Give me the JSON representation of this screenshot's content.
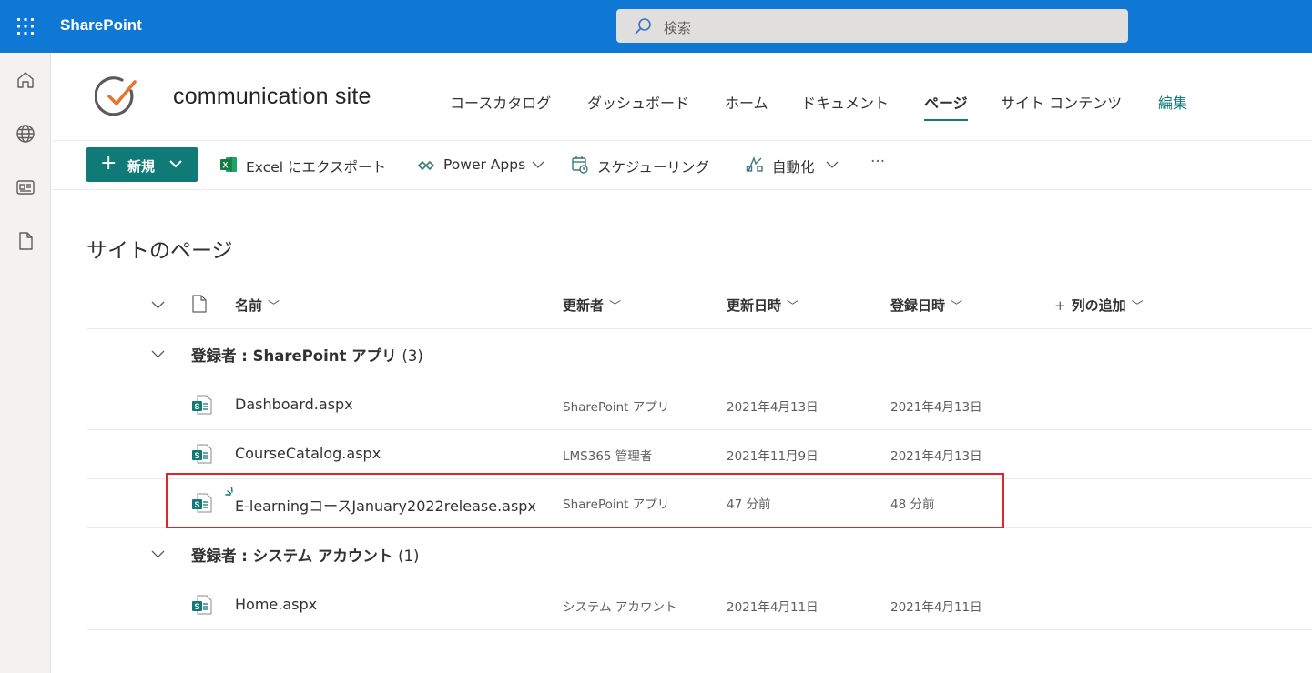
{
  "suite_bar": {
    "app_name": "SharePoint",
    "search_placeholder": "検索",
    "background": "#0f78d4"
  },
  "app_bar": {
    "icons": [
      "home-icon",
      "globe-icon",
      "news-icon",
      "file-icon"
    ]
  },
  "site": {
    "title": "communication site",
    "nav": [
      "コースカタログ",
      "ダッシュボード",
      "ホーム",
      "ドキュメント",
      "ページ",
      "サイト コンテンツ"
    ],
    "active_nav": "ページ",
    "edit_label": "編集",
    "accent": "#0f7a76"
  },
  "command_bar": {
    "new_label": "新規",
    "export_label": "Excel にエクスポート",
    "power_apps_label": "Power Apps",
    "schedule_label": "スケジューリング",
    "automate_label": "自動化",
    "more_label": "···"
  },
  "page": {
    "title": "サイトのページ",
    "columns": {
      "name": "名前",
      "modified_by": "更新者",
      "modified": "更新日時",
      "created": "登録日時",
      "add_column": "列の追加"
    },
    "groups": [
      {
        "label": "登録者 : SharePoint アプリ",
        "count": "(3)",
        "rows": [
          {
            "name": "Dashboard.aspx",
            "modified_by": "SharePoint アプリ",
            "modified": "2021年4月13日",
            "created": "2021年4月13日"
          },
          {
            "name": "CourseCatalog.aspx",
            "modified_by": "LMS365 管理者",
            "modified": "2021年11月9日",
            "created": "2021年4月13日"
          },
          {
            "name": "E-learningコースJanuary2022release.aspx",
            "modified_by": "SharePoint アプリ",
            "modified": "47 分前",
            "created": "48 分前",
            "is_new": true
          }
        ]
      },
      {
        "label": "登録者 : システム アカウント",
        "count": "(1)",
        "rows": [
          {
            "name": "Home.aspx",
            "modified_by": "システム アカウント",
            "modified": "2021年4月11日",
            "created": "2021年4月11日"
          }
        ]
      }
    ],
    "highlight_color": "#e0262c"
  }
}
